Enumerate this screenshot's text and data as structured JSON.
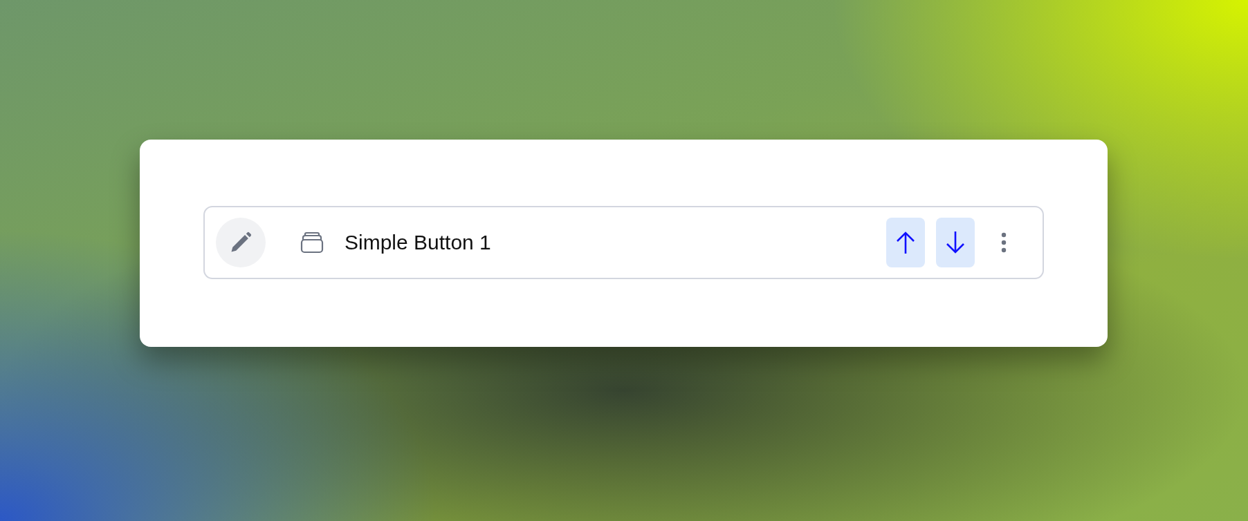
{
  "item": {
    "label": "Simple Button 1"
  }
}
